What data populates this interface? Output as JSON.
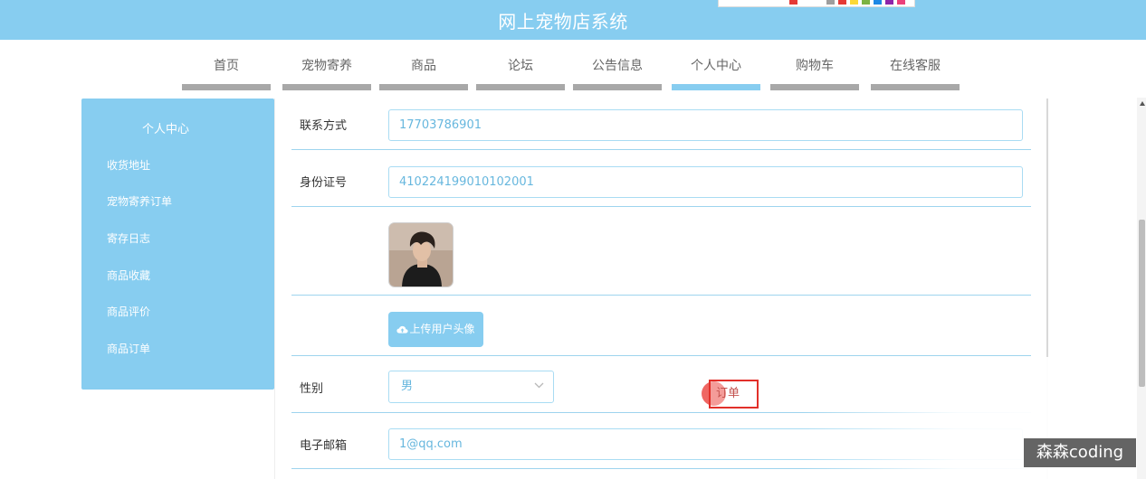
{
  "header": {
    "title": "网上宠物店系统"
  },
  "palette": {
    "colors": [
      "#e53935",
      "#ffffff",
      "#9e9e9e",
      "#e53935",
      "#fdd835",
      "#7cb342",
      "#1e88e5",
      "#8e24aa",
      "#ec407a",
      "#26c6da"
    ]
  },
  "nav": {
    "items": [
      {
        "label": "首页"
      },
      {
        "label": "宠物寄养"
      },
      {
        "label": "商品"
      },
      {
        "label": "论坛"
      },
      {
        "label": "公告信息"
      },
      {
        "label": "个人中心",
        "active": true
      },
      {
        "label": "购物车"
      },
      {
        "label": "在线客服"
      }
    ]
  },
  "sidebar": {
    "title": "个人中心",
    "items": [
      {
        "label": "收货地址"
      },
      {
        "label": "宠物寄养订单"
      },
      {
        "label": "寄存日志"
      },
      {
        "label": "商品收藏"
      },
      {
        "label": "商品评价"
      },
      {
        "label": "商品订单"
      }
    ]
  },
  "form": {
    "contact": {
      "label": "联系方式",
      "value": "17703786901"
    },
    "id_card": {
      "label": "身份证号",
      "value": "410224199010102001"
    },
    "upload": {
      "label": "上传用户头像",
      "icon": "cloud-upload-icon"
    },
    "gender": {
      "label": "性别",
      "value": "男"
    },
    "email": {
      "label": "电子邮箱",
      "value": "1@qq.com"
    }
  },
  "tooltip": {
    "text": "订单"
  },
  "watermark": {
    "text": "森森coding"
  },
  "colors": {
    "accent": "#87cdf0",
    "nav_inactive": "#a8a8a8",
    "highlight": "#e2302a"
  }
}
